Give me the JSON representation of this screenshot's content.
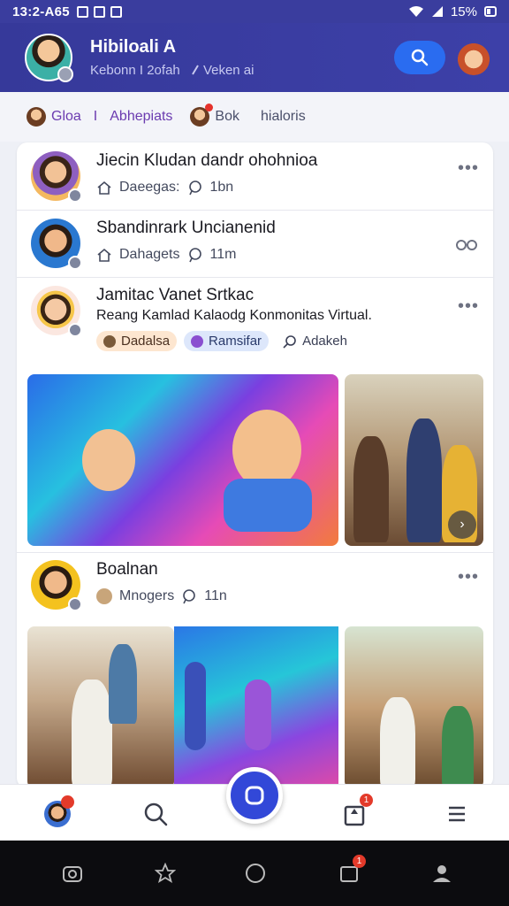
{
  "status_bar": {
    "time": "13:2-A65",
    "battery": "15%"
  },
  "header": {
    "title": "Hibiloali A",
    "subtitle_left": "Kebonn I 2ofah",
    "subtitle_right": "Veken ai"
  },
  "filters": {
    "items": [
      {
        "label": "Gloa"
      },
      {
        "label": "Abhepiats"
      },
      {
        "label": "Bok"
      },
      {
        "label": "hialoris"
      }
    ],
    "divider": "I"
  },
  "feed": {
    "posts": [
      {
        "name": "Jiecin Kludan dandr ohohnioa",
        "meta": "Daeegas: ",
        "count": "1bn"
      },
      {
        "name": "Sbandinrark Uncianenid",
        "meta": "Dahagets",
        "count": "11m"
      },
      {
        "name": "Jamitac Vanet Srtkac",
        "desc": "Reang Kamlad Kalaodg Konmonitas Virtual.",
        "tags": [
          "Dadalsa",
          "Ramsifar",
          "Adakeh"
        ]
      },
      {
        "name": "Boalnan",
        "meta": "Mnogers",
        "count": "11n"
      }
    ],
    "more": "•••"
  },
  "bottom_nav": {
    "fab_icon": "square-rounded-icon",
    "badge_count": "1"
  },
  "colors": {
    "header_bg": "#3a3d9e",
    "accent_blue": "#2a6cf0",
    "fab_blue": "#3248d8",
    "badge_red": "#e33a2a"
  }
}
